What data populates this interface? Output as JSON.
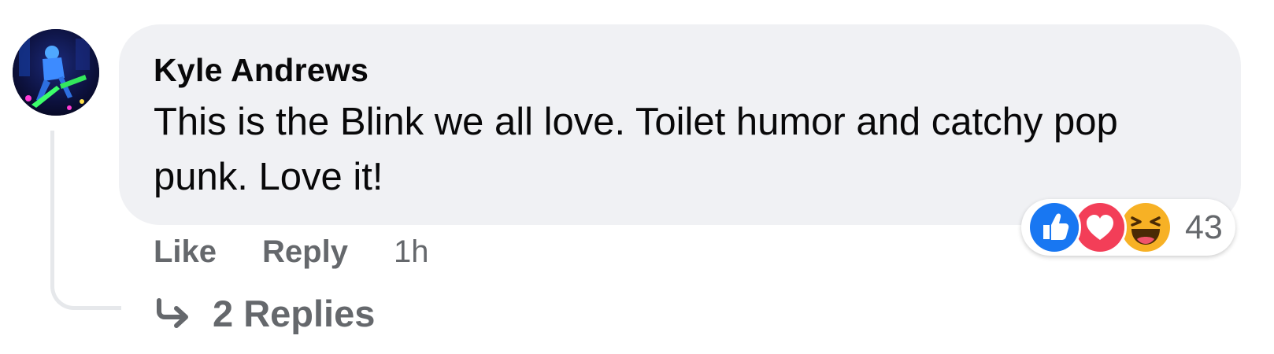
{
  "comment": {
    "author": "Kyle Andrews",
    "text": "This is the Blink we all love. Toilet humor and catchy pop punk. Love it!",
    "avatar_icon": "profile-photo"
  },
  "actions": {
    "like_label": "Like",
    "reply_label": "Reply",
    "timestamp": "1h"
  },
  "reactions": {
    "icons": [
      "like-icon",
      "love-icon",
      "haha-icon"
    ],
    "count": "43",
    "colors": {
      "like": "#1877f2",
      "love": "#f33e58",
      "haha": "#f7b125"
    }
  },
  "replies": {
    "label": "2 Replies",
    "icon": "reply-arrow-icon"
  }
}
